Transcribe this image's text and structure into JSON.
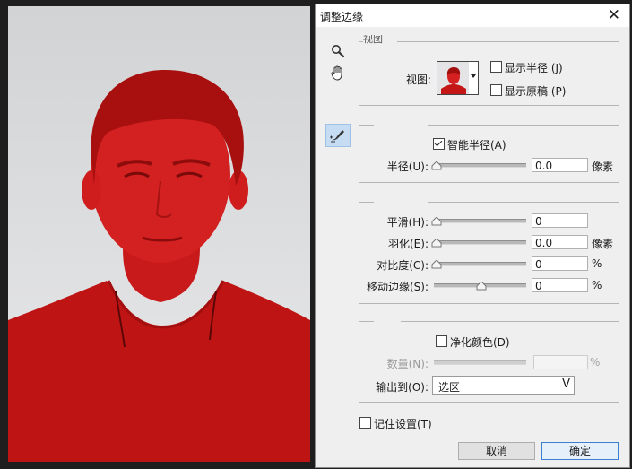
{
  "dialog": {
    "title": "调整边缘",
    "close_glyph": "✕"
  },
  "tools": [
    {
      "name": "zoom-tool",
      "icon": "magnifier-icon"
    },
    {
      "name": "hand-tool",
      "icon": "hand-icon"
    },
    {
      "name": "refine-radius-tool",
      "icon": "refine-brush-icon"
    }
  ],
  "view_mode": {
    "header": "视图",
    "view_label": "视图:",
    "show_radius": {
      "label": "显示半径 (J)",
      "checked": false
    },
    "show_original": {
      "label": "显示原稿 (P)",
      "checked": false
    }
  },
  "edge_detection": {
    "smart_radius": {
      "label": "智能半径(A)",
      "checked": true
    },
    "radius": {
      "label": "半径(U):",
      "value": "0.0",
      "unit": "像素",
      "level": 0
    }
  },
  "adjust_edge": {
    "smooth": {
      "label": "平滑(H):",
      "value": "0",
      "unit": "",
      "level": 0
    },
    "feather": {
      "label": "羽化(E):",
      "value": "0.0",
      "unit": "像素",
      "level": 0
    },
    "contrast": {
      "label": "对比度(C):",
      "value": "0",
      "unit": "%",
      "level": 0
    },
    "shift_edge": {
      "label": "移动边缘(S):",
      "value": "0",
      "unit": "%",
      "level": 0.5
    }
  },
  "output": {
    "decontaminate": {
      "label": "净化颜色(D)",
      "checked": false
    },
    "amount": {
      "label": "数量(N):",
      "value": "",
      "unit": "%",
      "level": 0.5,
      "disabled": true
    },
    "output_to_label": "输出到(O):",
    "output_to_value": "选区",
    "dropdown_glyph": "V"
  },
  "remember": {
    "label": "记住设置(T)",
    "checked": false
  },
  "buttons": {
    "cancel": "取消",
    "ok": "确定"
  },
  "colors": {
    "overlay_red": "#cc1111",
    "dialog_bg": "#efefef",
    "accent_border": "#3c7fd1"
  }
}
